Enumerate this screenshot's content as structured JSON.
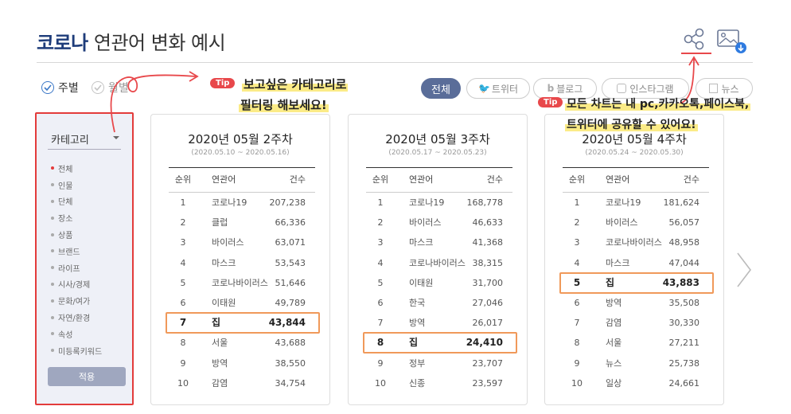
{
  "header": {
    "title_highlight": "코로나",
    "title_rest": " 연관어 변화 예시"
  },
  "icons": {
    "share": "share-icon",
    "image_download": "image-download-icon"
  },
  "period": {
    "weekly": "주별",
    "monthly": "월별"
  },
  "filters": [
    "전체",
    "트위터",
    "블로그",
    "인스타그램",
    "뉴스"
  ],
  "sidebar": {
    "select_label": "카테고리",
    "categories": [
      "전체",
      "인물",
      "단체",
      "장소",
      "상품",
      "브랜드",
      "라이프",
      "시사/경제",
      "문화/여가",
      "자연/환경",
      "속성",
      "미등록키워드"
    ],
    "apply": "적용"
  },
  "table_headers": {
    "rank": "순위",
    "term": "연관어",
    "count": "건수"
  },
  "cards": [
    {
      "title": "2020년 05월 2주차",
      "range": "(2020.05.10 ~ 2020.05.16)",
      "highlight_rank": "7",
      "rows": [
        {
          "rank": "1",
          "term": "코로나19",
          "count": "207,238"
        },
        {
          "rank": "2",
          "term": "클럽",
          "count": "66,336"
        },
        {
          "rank": "3",
          "term": "바이러스",
          "count": "63,071"
        },
        {
          "rank": "4",
          "term": "마스크",
          "count": "53,543"
        },
        {
          "rank": "5",
          "term": "코로나바이러스",
          "count": "51,646"
        },
        {
          "rank": "6",
          "term": "이태원",
          "count": "49,789"
        },
        {
          "rank": "7",
          "term": "집",
          "count": "43,844"
        },
        {
          "rank": "8",
          "term": "서울",
          "count": "43,688"
        },
        {
          "rank": "9",
          "term": "방역",
          "count": "38,550"
        },
        {
          "rank": "10",
          "term": "감염",
          "count": "34,754"
        }
      ]
    },
    {
      "title": "2020년 05월 3주차",
      "range": "(2020.05.17 ~ 2020.05.23)",
      "highlight_rank": "8",
      "rows": [
        {
          "rank": "1",
          "term": "코로나19",
          "count": "168,778"
        },
        {
          "rank": "2",
          "term": "바이러스",
          "count": "46,633"
        },
        {
          "rank": "3",
          "term": "마스크",
          "count": "41,368"
        },
        {
          "rank": "4",
          "term": "코로나바이러스",
          "count": "38,315"
        },
        {
          "rank": "5",
          "term": "이태원",
          "count": "31,700"
        },
        {
          "rank": "6",
          "term": "한국",
          "count": "27,046"
        },
        {
          "rank": "7",
          "term": "방역",
          "count": "26,017"
        },
        {
          "rank": "8",
          "term": "집",
          "count": "24,410"
        },
        {
          "rank": "9",
          "term": "정부",
          "count": "23,707"
        },
        {
          "rank": "10",
          "term": "신종",
          "count": "23,597"
        }
      ]
    },
    {
      "title": "2020년 05월 4주차",
      "range": "(2020.05.24 ~ 2020.05.30)",
      "highlight_rank": "5",
      "rows": [
        {
          "rank": "1",
          "term": "코로나19",
          "count": "181,624"
        },
        {
          "rank": "2",
          "term": "바이러스",
          "count": "56,057"
        },
        {
          "rank": "3",
          "term": "코로나바이러스",
          "count": "48,958"
        },
        {
          "rank": "4",
          "term": "마스크",
          "count": "47,044"
        },
        {
          "rank": "5",
          "term": "집",
          "count": "43,883"
        },
        {
          "rank": "6",
          "term": "방역",
          "count": "35,508"
        },
        {
          "rank": "7",
          "term": "감염",
          "count": "30,330"
        },
        {
          "rank": "8",
          "term": "서울",
          "count": "27,211"
        },
        {
          "rank": "9",
          "term": "뉴스",
          "count": "25,738"
        },
        {
          "rank": "10",
          "term": "일상",
          "count": "24,661"
        }
      ]
    }
  ],
  "tips": {
    "badge": "Tip",
    "tip1_line1": "보고싶은 카테고리로",
    "tip1_line2": "필터링 해보세요!",
    "tip2_line1": "모든 차트는 내 pc,카카오톡,페이스북,",
    "tip2_line2": "트위터에 공유할 수 있어요!"
  },
  "colors": {
    "accent": "#1e3c7a",
    "highlight_box": "#f0995a",
    "annotation_red": "#e8484b",
    "active_pill": "#5a6d99"
  }
}
